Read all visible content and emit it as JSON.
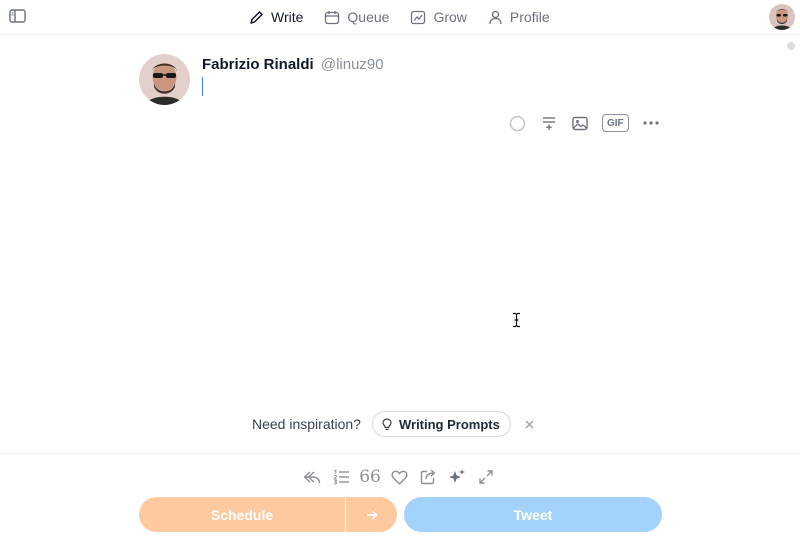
{
  "nav": {
    "sidebar_toggle_icon": "sidebar-panel-icon",
    "items": [
      {
        "label": "Write",
        "icon": "pencil-icon",
        "active": true
      },
      {
        "label": "Queue",
        "icon": "calendar-icon",
        "active": false
      },
      {
        "label": "Grow",
        "icon": "chart-icon",
        "active": false
      },
      {
        "label": "Profile",
        "icon": "user-icon",
        "active": false
      }
    ]
  },
  "composer": {
    "author_name": "Fabrizio Rinaldi",
    "author_handle": "@linuz90",
    "text": "",
    "tools": [
      "progress-circle-icon",
      "insert-break-icon",
      "image-icon",
      "GIF",
      "more-icon"
    ]
  },
  "inspiration": {
    "prompt_text": "Need inspiration?",
    "button_label": "Writing Prompts",
    "button_icon": "lightbulb-icon"
  },
  "bottom_toolbar": {
    "tools": [
      "reply-icon",
      "numbered-list-icon",
      "quote-icon",
      "heart-icon",
      "share-icon",
      "sparkle-icon",
      "expand-icon"
    ],
    "quote_glyph": "66"
  },
  "actions": {
    "schedule_label": "Schedule",
    "tweet_label": "Tweet"
  },
  "colors": {
    "schedule": "#fec99e",
    "tweet": "#a3d2fa",
    "caret": "#3b82f6"
  }
}
